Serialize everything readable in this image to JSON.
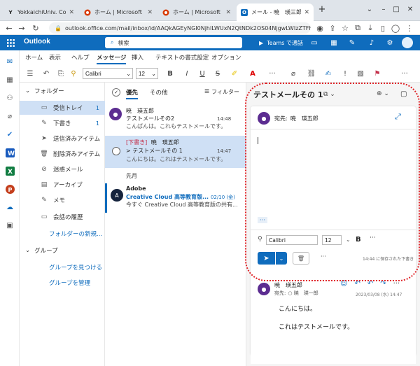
{
  "browser": {
    "tabs": [
      {
        "label": "YokkaichiUniv. Compute",
        "icon": "Y"
      },
      {
        "label": "ホーム | Microsoft 365",
        "icon": "365"
      },
      {
        "label": "ホーム | Microsoft 365",
        "icon": "365"
      },
      {
        "label": "メール - 暁　瑛三郎 - Out",
        "icon": "O"
      }
    ],
    "url": "outlook.office.com/mail/inbox/id/AAQkAGEyNGI0NjhlLWUxN2QtNDk2OS04NjgwLWIzZTFhYjdlZGJhY...",
    "new_tab": "+"
  },
  "header": {
    "brand": "Outlook",
    "search_placeholder": "検索",
    "teams_label": "Teams で通話"
  },
  "ribbon": {
    "tabs": [
      "ホーム",
      "表示",
      "ヘルプ",
      "メッセージ",
      "挿入",
      "テキストの書式設定",
      "オプション"
    ],
    "font": "Calibri",
    "size": "12",
    "more": "···"
  },
  "folders": {
    "header": "フォルダー",
    "items": [
      {
        "label": "受信トレイ",
        "count": "1"
      },
      {
        "label": "下書き",
        "count": "1"
      },
      {
        "label": "送信済みアイテム",
        "count": ""
      },
      {
        "label": "削除済みアイテム",
        "count": ""
      },
      {
        "label": "迷惑メール",
        "count": ""
      },
      {
        "label": "アーカイブ",
        "count": ""
      },
      {
        "label": "メモ",
        "count": ""
      },
      {
        "label": "会話の履歴",
        "count": ""
      }
    ],
    "new_folder": "フォルダーの新規...",
    "groups_header": "グループ",
    "find_groups": "グループを見つける",
    "manage_groups": "グループを管理"
  },
  "message_list": {
    "tab_focused": "優先",
    "tab_other": "その他",
    "filter": "フィルター",
    "month_header": "先月",
    "messages": [
      {
        "sender": "暁　瑛五郎",
        "subject": "テストメールその2",
        "preview": "こんばんは。これもテストメールです。",
        "time": "14:48",
        "draft": ""
      },
      {
        "sender": "暁　瑛五郎",
        "subject": "> テストメールその 1",
        "preview": "こんにちは。これはテストメールです。",
        "time": "14:47",
        "draft": "[下書き]"
      },
      {
        "sender": "Adobe",
        "subject": "Creative Cloud 高等教育版...",
        "preview": "今すぐ Creative Cloud 高等教育版の共有...",
        "time": "02/10 (金)",
        "draft": "",
        "avatar": "A"
      }
    ]
  },
  "compose": {
    "title": "テストメールその 1",
    "to_label": "宛先:",
    "to_value": "暁　瑛五郎",
    "ellipsis": "···",
    "font": "Calibri",
    "size": "12",
    "bold": "B",
    "more": "···",
    "saved_status": "14:44 に保存された下書き"
  },
  "reading": {
    "sender": "暁　瑛五郎",
    "to_label": "宛先:",
    "to_value": "○ 暁　瑛一郎",
    "date": "2023/03/08 (水) 14:47",
    "body_line1": "こんにちは。",
    "body_line2": "これはテストメールです。"
  },
  "colors": {
    "accent": "#0f6cbd",
    "selected": "#cfe0f5",
    "highlight": "#e0252a",
    "draft_red": "#c4314b"
  }
}
